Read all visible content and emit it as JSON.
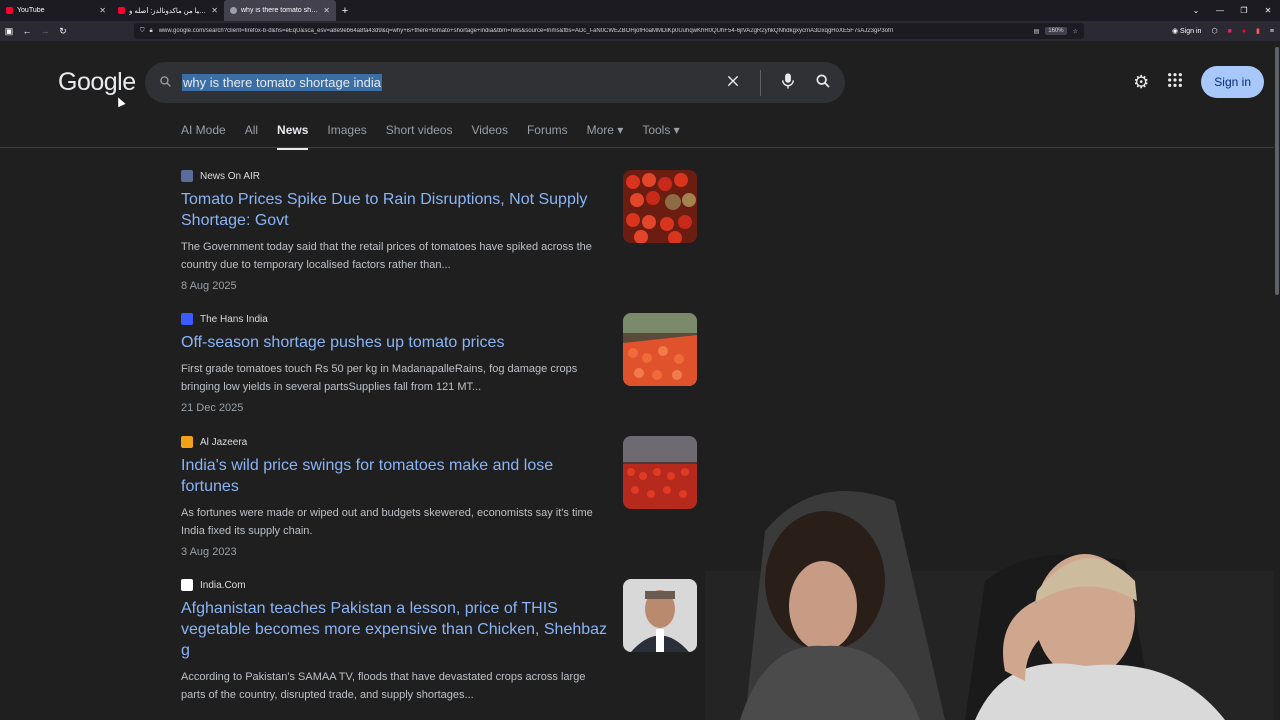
{
  "browser": {
    "tabs": [
      {
        "title": "YouTube",
        "favicon_color": "#ff0033"
      },
      {
        "title": "ماك أرابيا من ماكدونالدز: أصله و...",
        "favicon_color": "#ff0033"
      },
      {
        "title": "why is there tomato shortage india",
        "favicon_color": "#9aa0a6"
      }
    ],
    "new_tab": "+",
    "url": "www.google.com/search?client=firefox-b-d&hs=eEqU&sca_esv=a8e9eb64a8fa43d9&q=why+is+there+tomato+shortage+india&tbm=nws&source=lnms&fbs=ADc_l-aN0CWEZBOHjofHoaMMDiKp0UuhqwKhR0QUhF54-6jlVA2gR2yhkQNhdkgxycmA3DxqgHoXE5F7sAJ23gP3ofrl",
    "zoom": "160%",
    "signin_label": "Sign in"
  },
  "google": {
    "logo": "Google",
    "query": "why is there tomato shortage india",
    "signin": "Sign in",
    "tabs": [
      "AI Mode",
      "All",
      "News",
      "Images",
      "Short videos",
      "Videos",
      "Forums",
      "More ▾",
      "Tools ▾"
    ],
    "active_tab": "News"
  },
  "results": [
    {
      "source": "News On AIR",
      "fav_color": "#5b6b9a",
      "title": "Tomato Prices Spike Due to Rain Disruptions, Not Supply Shortage: Govt",
      "snippet": "The Government today said that the retail prices of tomatoes have spiked across the country due to temporary localised factors rather than...",
      "date": "8 Aug 2025"
    },
    {
      "source": "The Hans India",
      "fav_color": "#3d5afe",
      "title": "Off-season shortage pushes up tomato prices",
      "snippet": "First grade tomatoes touch Rs 50 per kg in MadanapalleRains, fog damage crops bringing low yields in several partsSupplies fall from 121 MT...",
      "date": "21 Dec 2025"
    },
    {
      "source": "Al Jazeera",
      "fav_color": "#f4a11a",
      "title": "India's wild price swings for tomatoes make and lose fortunes",
      "snippet": "As fortunes were made or wiped out and budgets skewered, economists say it's time India fixed its supply chain.",
      "date": "3 Aug 2023"
    },
    {
      "source": "India.Com",
      "fav_color": "#ffffff",
      "title": "Afghanistan teaches Pakistan a lesson, price of THIS vegetable becomes more expensive than Chicken, Shehbaz g",
      "snippet": "According to Pakistan's SAMAA TV, floods that have devastated crops across large parts of the country, disrupted trade, and supply shortages...",
      "date": ""
    }
  ],
  "colors": {
    "link": "#8ab4f8",
    "bg": "#1f1f1f",
    "accent": "#a8c7fa"
  }
}
